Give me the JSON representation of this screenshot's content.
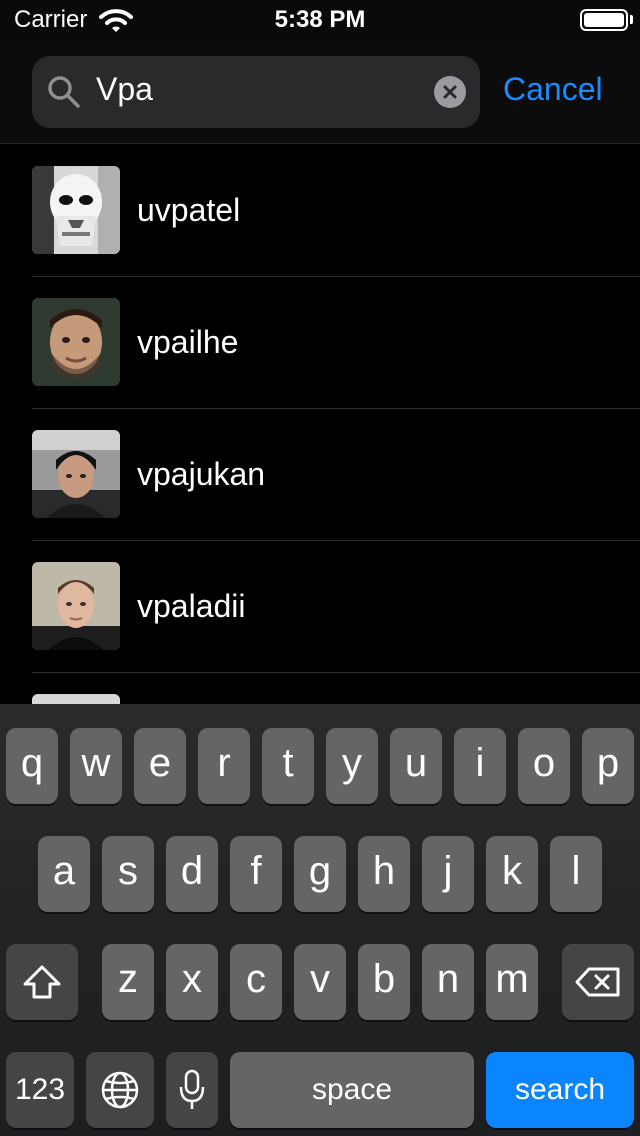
{
  "status_bar": {
    "carrier": "Carrier",
    "time": "5:38 PM",
    "battery_level": 1.0
  },
  "search": {
    "query": "Vpa",
    "cancel_label": "Cancel"
  },
  "results": [
    {
      "username": "uvpatel",
      "avatar_icon": "stormtrooper-avatar"
    },
    {
      "username": "vpailhe",
      "avatar_icon": "user-photo-avatar"
    },
    {
      "username": "vpajukan",
      "avatar_icon": "user-photo-avatar"
    },
    {
      "username": "vpaladii",
      "avatar_icon": "user-photo-avatar"
    }
  ],
  "keyboard": {
    "row1": [
      "q",
      "w",
      "e",
      "r",
      "t",
      "y",
      "u",
      "i",
      "o",
      "p"
    ],
    "row2": [
      "a",
      "s",
      "d",
      "f",
      "g",
      "h",
      "j",
      "k",
      "l"
    ],
    "row3": [
      "z",
      "x",
      "c",
      "v",
      "b",
      "n",
      "m"
    ],
    "numbers_label": "123",
    "space_label": "space",
    "return_label": "search"
  },
  "colors": {
    "accent": "#1a8cff",
    "search_key": "#0a84ff"
  }
}
